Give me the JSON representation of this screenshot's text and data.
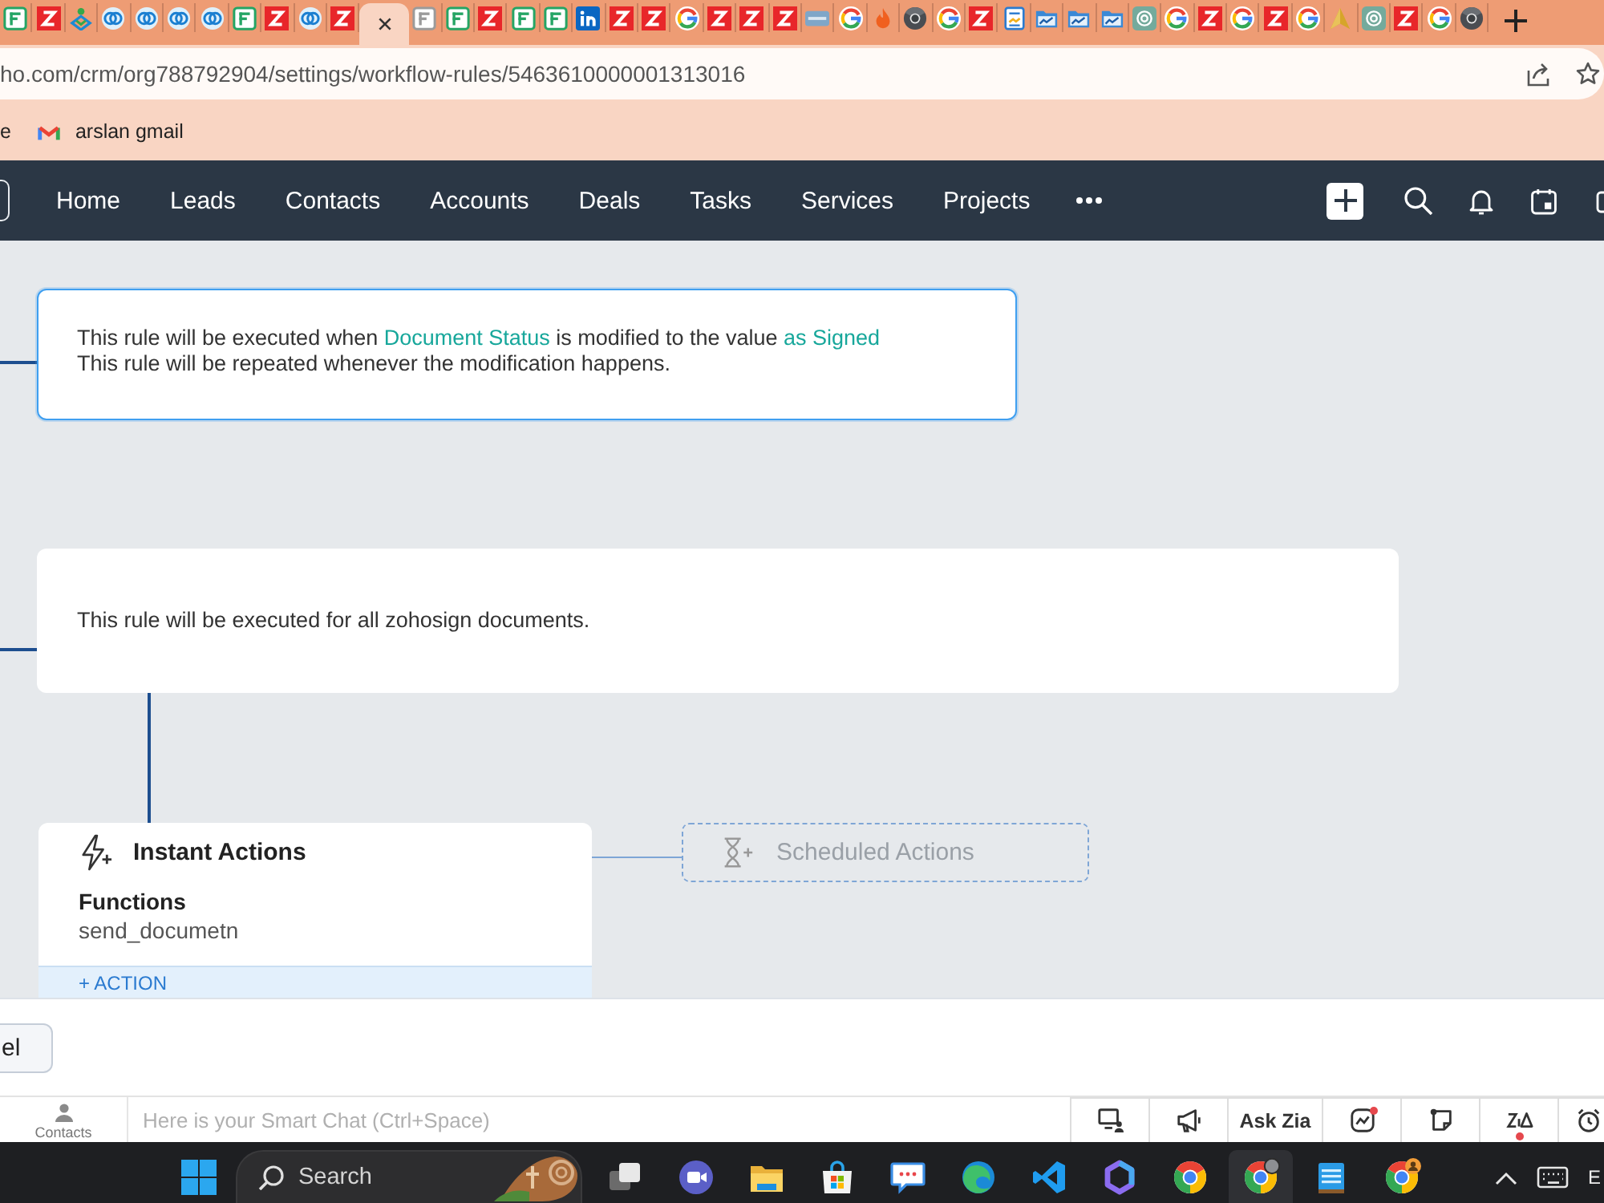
{
  "browser": {
    "tabs": [
      {
        "kind": "forms",
        "selected": false
      },
      {
        "kind": "zoho",
        "selected": false
      },
      {
        "kind": "cliq",
        "selected": false
      },
      {
        "kind": "ring",
        "selected": false
      },
      {
        "kind": "ring",
        "selected": false
      },
      {
        "kind": "ring",
        "selected": false
      },
      {
        "kind": "ring",
        "selected": false
      },
      {
        "kind": "forms",
        "selected": false
      },
      {
        "kind": "zoho",
        "selected": false
      },
      {
        "kind": "ring",
        "selected": false
      },
      {
        "kind": "zoho",
        "selected": false
      },
      {
        "kind": "none",
        "selected": true
      },
      {
        "kind": "formsgrey",
        "selected": false
      },
      {
        "kind": "forms",
        "selected": false
      },
      {
        "kind": "zoho",
        "selected": false
      },
      {
        "kind": "forms",
        "selected": false
      },
      {
        "kind": "forms",
        "selected": false
      },
      {
        "kind": "linkedin",
        "selected": false
      },
      {
        "kind": "zoho",
        "selected": false
      },
      {
        "kind": "zoho",
        "selected": false
      },
      {
        "kind": "google",
        "selected": false
      },
      {
        "kind": "zoho",
        "selected": false
      },
      {
        "kind": "zoho",
        "selected": false
      },
      {
        "kind": "zoho",
        "selected": false
      },
      {
        "kind": "tmg",
        "selected": false
      },
      {
        "kind": "google",
        "selected": false
      },
      {
        "kind": "flame",
        "selected": false
      },
      {
        "kind": "chromedark",
        "selected": false
      },
      {
        "kind": "google",
        "selected": false
      },
      {
        "kind": "zoho",
        "selected": false
      },
      {
        "kind": "doc",
        "selected": false
      },
      {
        "kind": "folder",
        "selected": false
      },
      {
        "kind": "folder",
        "selected": false
      },
      {
        "kind": "folder",
        "selected": false
      },
      {
        "kind": "openai",
        "selected": false
      },
      {
        "kind": "google",
        "selected": false
      },
      {
        "kind": "zoho",
        "selected": false
      },
      {
        "kind": "google",
        "selected": false
      },
      {
        "kind": "zoho",
        "selected": false
      },
      {
        "kind": "google",
        "selected": false
      },
      {
        "kind": "arrow",
        "selected": false
      },
      {
        "kind": "openai",
        "selected": false
      },
      {
        "kind": "zoho",
        "selected": false
      },
      {
        "kind": "google",
        "selected": false
      },
      {
        "kind": "chromedark",
        "selected": false
      }
    ],
    "address_bar": {
      "value": "ho.com/crm/org788792904/settings/workflow-rules/5463610000001313016"
    },
    "bookmarks": [
      {
        "kind": "plain",
        "label": "e"
      },
      {
        "kind": "gmail",
        "label": "arslan gmail"
      }
    ]
  },
  "nav": {
    "items": [
      "Home",
      "Leads",
      "Contacts",
      "Accounts",
      "Deals",
      "Tasks",
      "Services",
      "Projects"
    ]
  },
  "workflow": {
    "trigger": {
      "selected": true,
      "parts": [
        {
          "kind": "plain",
          "text": "This rule will be executed when "
        },
        {
          "kind": "link",
          "text": "Document Status"
        },
        {
          "kind": "plain",
          "text": " is modified to the value "
        },
        {
          "kind": "link",
          "text": "as Signed"
        }
      ],
      "note": "This rule will be repeated whenever the modification happens."
    },
    "criteria": {
      "selected": false,
      "text": "This rule will be executed for all zohosign documents."
    },
    "instant_actions": {
      "title": "Instant Actions",
      "group": "Functions",
      "items": [
        "send_documetn"
      ],
      "add_label": "+ ACTION"
    },
    "scheduled_actions": {
      "title": "Scheduled Actions"
    }
  },
  "footer": {
    "buttons": [
      "el"
    ]
  },
  "smart_chat": {
    "contacts_label": "Contacts",
    "placeholder": "Here is your Smart Chat (Ctrl+Space)",
    "tools": [
      {
        "kind": "presenter",
        "dot": false
      },
      {
        "kind": "megaphone",
        "dot": false
      },
      {
        "kind": "text",
        "label": "Ask Zia",
        "dot": false
      },
      {
        "kind": "chart",
        "dot": true
      },
      {
        "kind": "note",
        "dot": false
      },
      {
        "kind": "zia",
        "dot": true
      },
      {
        "kind": "clock",
        "dot": false
      }
    ]
  },
  "taskbar": {
    "search": {
      "placeholder": "Search"
    },
    "apps": [
      {
        "kind": "taskview",
        "selected": false
      },
      {
        "kind": "meet",
        "selected": false
      },
      {
        "kind": "explorer",
        "selected": false
      },
      {
        "kind": "store",
        "selected": false
      },
      {
        "kind": "feedback",
        "selected": false
      },
      {
        "kind": "edge",
        "selected": false
      },
      {
        "kind": "vscode",
        "selected": false
      },
      {
        "kind": "copilot",
        "selected": false
      },
      {
        "kind": "chrome",
        "selected": false
      },
      {
        "kind": "chromeprofile",
        "selected": true
      },
      {
        "kind": "notepad",
        "selected": false
      },
      {
        "kind": "chromeperson",
        "selected": false
      }
    ],
    "language": "E"
  }
}
